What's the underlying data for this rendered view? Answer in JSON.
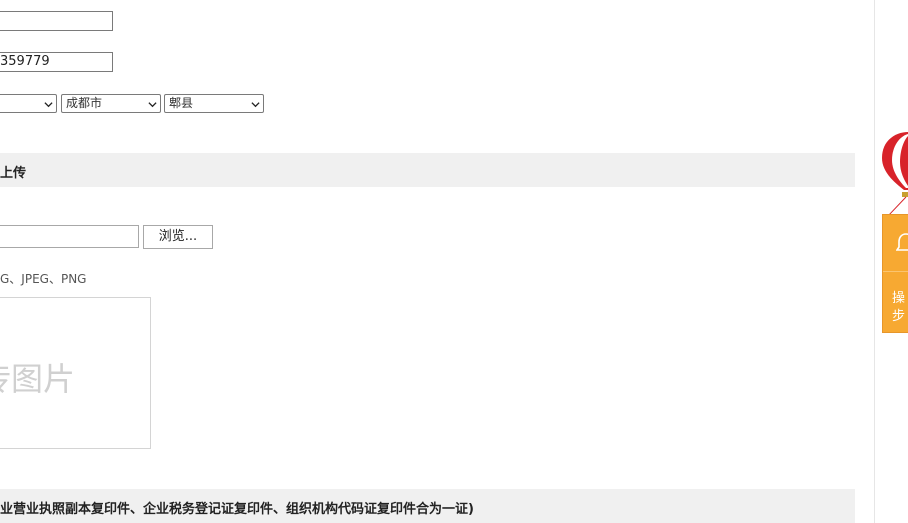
{
  "form": {
    "field1_value": "",
    "phone_value": "359779",
    "region": {
      "province_value": "",
      "city_value": "成都市",
      "county_value": "郫县"
    }
  },
  "upload_section": {
    "title": "上传",
    "browse_label": "浏览...",
    "format_hint": "G、JPEG、PNG",
    "preview_placeholder": "传图片"
  },
  "license_section": {
    "title": "业营业执照副本复印件、企业税务登记证复印件、组织机构代码证复印件合为一证)"
  },
  "float_widget": {
    "icon": "bell-icon",
    "balloon_icon": "hot-air-balloon-icon",
    "text_line1": "操",
    "text_line2": "步"
  },
  "colors": {
    "widget_orange": "#f7a932",
    "section_bg": "#f0f0f0"
  }
}
